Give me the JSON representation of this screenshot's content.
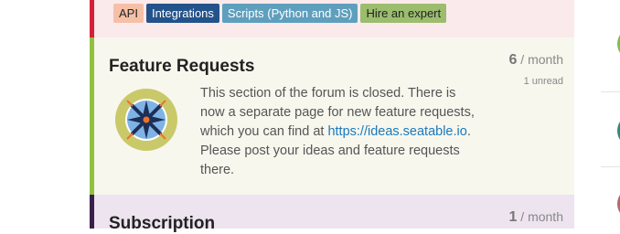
{
  "top_category": {
    "tags": [
      {
        "label": "API",
        "bg": "#f6c0a6",
        "fg": "#222222"
      },
      {
        "label": "Integrations",
        "bg": "#24528a",
        "fg": "#ffffff"
      },
      {
        "label": "Scripts (Python and JS)",
        "bg": "#5f9fbe",
        "fg": "#ffffff"
      },
      {
        "label": "Hire an expert",
        "bg": "#9bbd6d",
        "fg": "#222222"
      }
    ],
    "accent_color": "#d6203a"
  },
  "feature_category": {
    "title": "Feature Requests",
    "posts_count": "6",
    "posts_period": "/ month",
    "unread": "1 unread",
    "description_before": "This section of the forum is closed. There is now a separate page for new feature requests, which you can find at ",
    "link_text": "https://ideas.seatable.io",
    "description_after": ". Please post your ideas and feature requests there.",
    "logo_icon": "compass-icon",
    "accent_color": "#92c13f"
  },
  "subscription_category": {
    "title": "Subscription",
    "posts_count": "1",
    "posts_period": "/ month",
    "accent_color": "#3a1f4a"
  },
  "right_column": {
    "avatar_colors": [
      "#7cc04a",
      "#2e8b7a",
      "#b26a6a"
    ]
  }
}
